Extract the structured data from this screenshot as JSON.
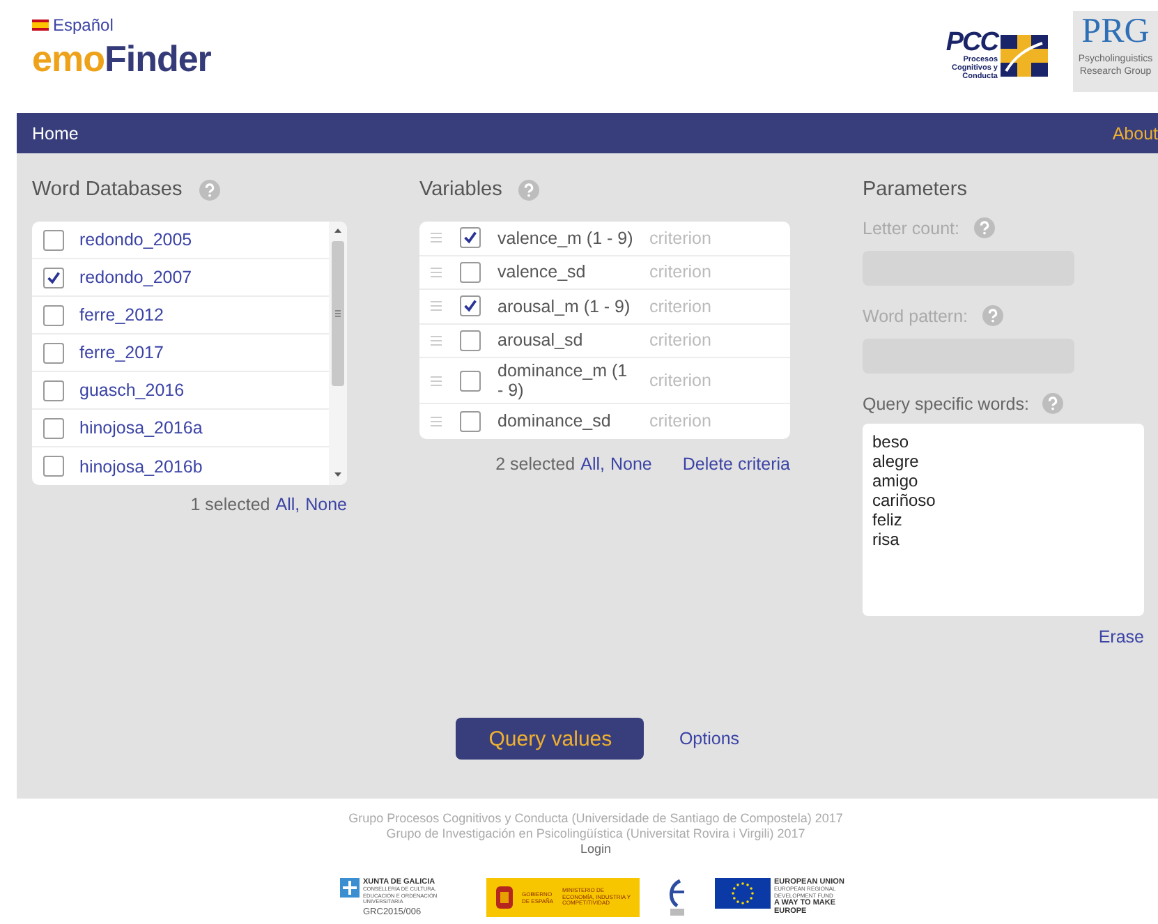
{
  "header": {
    "language": "Español",
    "logo_part_1": "emo",
    "logo_part_2": "Finder",
    "partner_logos": [
      {
        "kind": "pcc",
        "title": "PCC",
        "subtitle": "Procesos Cognitivos y Conducta"
      },
      {
        "kind": "prg",
        "title": "PRG",
        "subtitle": "Psycholinguistics Research Group"
      }
    ]
  },
  "nav": {
    "items": [
      {
        "label": "Home",
        "kind": "left"
      },
      {
        "label": "About",
        "kind": "right"
      }
    ]
  },
  "word_databases": {
    "title": "Word Databases",
    "items": [
      {
        "label": "redondo_2005",
        "checked": false
      },
      {
        "label": "redondo_2007",
        "checked": true
      },
      {
        "label": "ferre_2012",
        "checked": false
      },
      {
        "label": "ferre_2017",
        "checked": false
      },
      {
        "label": "guasch_2016",
        "checked": false
      },
      {
        "label": "hinojosa_2016a",
        "checked": false
      },
      {
        "label": "hinojosa_2016b",
        "checked": false
      }
    ],
    "status": "1 selected",
    "select_all": "All,",
    "select_none": "None"
  },
  "variables": {
    "title": "Variables",
    "items": [
      {
        "label": "valence_m (1 - 9)",
        "checked": true,
        "role": "criterion"
      },
      {
        "label": "valence_sd",
        "checked": false,
        "role": "criterion"
      },
      {
        "label": "arousal_m (1 - 9)",
        "checked": true,
        "role": "criterion"
      },
      {
        "label": "arousal_sd",
        "checked": false,
        "role": "criterion"
      },
      {
        "label": "dominance_m (1 - 9)",
        "checked": false,
        "role": "criterion"
      },
      {
        "label": "dominance_sd",
        "checked": false,
        "role": "criterion"
      }
    ],
    "status": "2 selected",
    "select_all": "All,",
    "select_none": "None",
    "delete": "Delete criteria"
  },
  "parameters": {
    "title": "Parameters",
    "fields": [
      {
        "label": "Letter count:",
        "disabled": true
      },
      {
        "label": "Word pattern:",
        "disabled": true
      }
    ],
    "words_label": "Query specific words:",
    "words": "beso\nalegre\namigo\ncariñoso\nfeliz\nrisa",
    "erase": "Erase"
  },
  "actions": {
    "query": "Query values",
    "options": "Options"
  },
  "footer": {
    "lines": [
      "Grupo Procesos Cognitivos y Conducta (Universidade de Santiago de Compostela) 2017",
      "Grupo de Investigación en Psicolingüística (Universitat Rovira i Virgili) 2017"
    ],
    "login": "Login",
    "sponsors": [
      {
        "kind": "xunta",
        "title": "XUNTA DE GALICIA",
        "text": "CONSELLERÍA DE CULTURA, EDUCACIÓN E ORDENACIÓN UNIVERSITARIA",
        "code": "GRC2015/006"
      },
      {
        "kind": "gobierno",
        "title": "GOBIERNO DE ESPAÑA",
        "text": "MINISTERIO DE ECONOMÍA, INDUSTRIA Y COMPETITIVIDAD"
      },
      {
        "kind": "erdf"
      },
      {
        "kind": "eu",
        "title": "EUROPEAN UNION",
        "text": "EUROPEAN REGIONAL DEVELOPMENT FUND",
        "code": "A WAY TO MAKE EUROPE"
      }
    ]
  }
}
